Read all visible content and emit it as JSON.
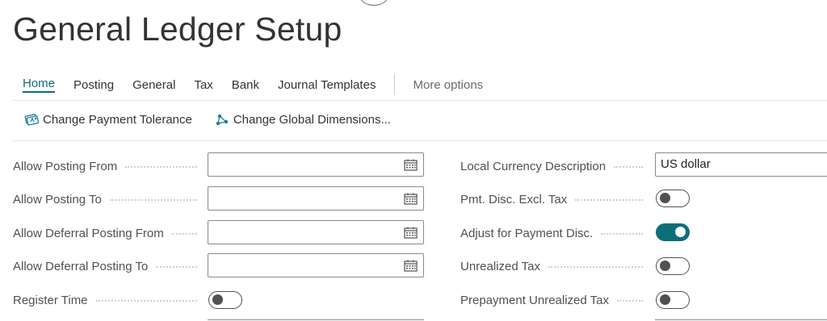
{
  "page": {
    "title": "General Ledger Setup"
  },
  "tabs": [
    {
      "label": "Home"
    },
    {
      "label": "Posting"
    },
    {
      "label": "General"
    },
    {
      "label": "Tax"
    },
    {
      "label": "Bank"
    },
    {
      "label": "Journal Templates"
    }
  ],
  "more_options_label": "More options",
  "actions": {
    "change_payment_tolerance": "Change Payment Tolerance",
    "change_global_dimensions": "Change Global Dimensions..."
  },
  "left_fields": {
    "allow_posting_from": {
      "label": "Allow Posting From",
      "value": ""
    },
    "allow_posting_to": {
      "label": "Allow Posting To",
      "value": ""
    },
    "allow_deferral_posting_from": {
      "label": "Allow Deferral Posting From",
      "value": ""
    },
    "allow_deferral_posting_to": {
      "label": "Allow Deferral Posting To",
      "value": ""
    },
    "register_time": {
      "label": "Register Time",
      "on": false
    }
  },
  "right_fields": {
    "local_currency_description": {
      "label": "Local Currency Description",
      "value": "US dollar"
    },
    "pmt_disc_excl_tax": {
      "label": "Pmt. Disc. Excl. Tax",
      "on": false
    },
    "adjust_for_payment_disc": {
      "label": "Adjust for Payment Disc.",
      "on": true
    },
    "unrealized_tax": {
      "label": "Unrealized Tax",
      "on": false
    },
    "prepayment_unrealized_tax": {
      "label": "Prepayment Unrealized Tax",
      "on": false
    }
  },
  "colors": {
    "accent": "#0f6a8c",
    "toggle_on": "#0e6e78"
  }
}
